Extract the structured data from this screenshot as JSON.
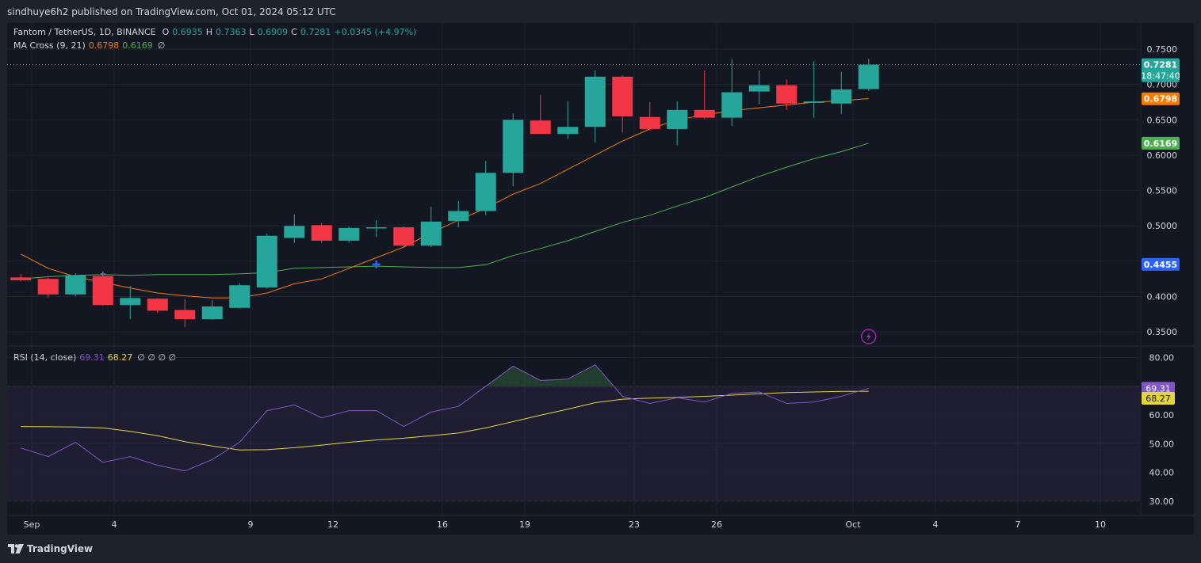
{
  "header": {
    "published_text": "sindhuye6h2 published on TradingView.com, Oct 01, 2024 05:12 UTC"
  },
  "main_legend": {
    "symbol": "Fantom / TetherUS, 1D, BINANCE",
    "o_label": "O",
    "o_value": "0.6935",
    "h_label": "H",
    "h_value": "0.7363",
    "l_label": "L",
    "l_value": "0.6909",
    "c_label": "C",
    "c_value": "0.7281",
    "change": "+0.0345 (+4.97%)"
  },
  "ma_legend": {
    "name": "MA Cross (9, 21)",
    "fast": "0.6798",
    "slow": "0.6169",
    "ghost": "∅"
  },
  "rsi_legend": {
    "name": "RSI (14, close)",
    "rsi": "69.31",
    "ma": "68.27",
    "ghosts": "∅ ∅ ∅ ∅"
  },
  "footer": {
    "brand": "TradingView",
    "logo_icon": "tradingview-logo-icon"
  },
  "colors": {
    "up": "#26a69a",
    "down": "#f23645",
    "ma_fast": "#f57c00",
    "ma_slow": "#4caf50",
    "rsi": "#7e57c2",
    "rsi_ma": "#e6d539",
    "cross_marker": "#2962ff"
  },
  "price_axis": {
    "ticks": [
      "0.7500",
      "0.7000",
      "0.6500",
      "0.6000",
      "0.5500",
      "0.5000",
      "0.4500",
      "0.4000",
      "0.3500"
    ],
    "badges": [
      {
        "label": "0.7281",
        "sub": "18:47:40",
        "color": "#26a69a"
      },
      {
        "label": "0.6798",
        "color": "#f57c00"
      },
      {
        "label": "0.6169",
        "color": "#4caf50"
      },
      {
        "label": "0.4455",
        "color": "#2962ff"
      }
    ]
  },
  "rsi_axis": {
    "ticks": [
      "80.00",
      "70.00",
      "60.00",
      "50.00",
      "40.00",
      "30.00"
    ],
    "badges": [
      {
        "label": "69.31",
        "color": "#7e57c2"
      },
      {
        "label": "68.27",
        "color": "#e6d539"
      }
    ]
  },
  "time_axis": {
    "labels": [
      "Sep",
      "4",
      "9",
      "12",
      "16",
      "19",
      "23",
      "26",
      "Oct",
      "4",
      "7",
      "10"
    ]
  },
  "chart_data": {
    "type": "candlestick",
    "candles": [
      {
        "o": 0.427,
        "h": 0.432,
        "l": 0.422,
        "c": 0.423
      },
      {
        "o": 0.425,
        "h": 0.427,
        "l": 0.398,
        "c": 0.403
      },
      {
        "o": 0.403,
        "h": 0.433,
        "l": 0.4,
        "c": 0.43
      },
      {
        "o": 0.429,
        "h": 0.434,
        "l": 0.387,
        "c": 0.388
      },
      {
        "o": 0.388,
        "h": 0.415,
        "l": 0.368,
        "c": 0.398
      },
      {
        "o": 0.397,
        "h": 0.398,
        "l": 0.377,
        "c": 0.38
      },
      {
        "o": 0.381,
        "h": 0.396,
        "l": 0.357,
        "c": 0.368
      },
      {
        "o": 0.368,
        "h": 0.395,
        "l": 0.367,
        "c": 0.386
      },
      {
        "o": 0.384,
        "h": 0.419,
        "l": 0.383,
        "c": 0.416
      },
      {
        "o": 0.413,
        "h": 0.489,
        "l": 0.411,
        "c": 0.486
      },
      {
        "o": 0.483,
        "h": 0.516,
        "l": 0.476,
        "c": 0.5
      },
      {
        "o": 0.501,
        "h": 0.504,
        "l": 0.476,
        "c": 0.479
      },
      {
        "o": 0.479,
        "h": 0.499,
        "l": 0.476,
        "c": 0.497
      },
      {
        "o": 0.497,
        "h": 0.508,
        "l": 0.484,
        "c": 0.498
      },
      {
        "o": 0.498,
        "h": 0.499,
        "l": 0.47,
        "c": 0.472
      },
      {
        "o": 0.472,
        "h": 0.527,
        "l": 0.47,
        "c": 0.506
      },
      {
        "o": 0.507,
        "h": 0.535,
        "l": 0.498,
        "c": 0.521
      },
      {
        "o": 0.521,
        "h": 0.592,
        "l": 0.515,
        "c": 0.575
      },
      {
        "o": 0.575,
        "h": 0.659,
        "l": 0.556,
        "c": 0.65
      },
      {
        "o": 0.649,
        "h": 0.685,
        "l": 0.63,
        "c": 0.63
      },
      {
        "o": 0.63,
        "h": 0.676,
        "l": 0.623,
        "c": 0.64
      },
      {
        "o": 0.64,
        "h": 0.72,
        "l": 0.618,
        "c": 0.711
      },
      {
        "o": 0.711,
        "h": 0.713,
        "l": 0.632,
        "c": 0.655
      },
      {
        "o": 0.654,
        "h": 0.675,
        "l": 0.635,
        "c": 0.637
      },
      {
        "o": 0.637,
        "h": 0.676,
        "l": 0.614,
        "c": 0.664
      },
      {
        "o": 0.664,
        "h": 0.72,
        "l": 0.651,
        "c": 0.653
      },
      {
        "o": 0.653,
        "h": 0.736,
        "l": 0.641,
        "c": 0.689
      },
      {
        "o": 0.69,
        "h": 0.72,
        "l": 0.672,
        "c": 0.699
      },
      {
        "o": 0.699,
        "h": 0.707,
        "l": 0.664,
        "c": 0.673
      },
      {
        "o": 0.674,
        "h": 0.733,
        "l": 0.653,
        "c": 0.676
      },
      {
        "o": 0.673,
        "h": 0.718,
        "l": 0.658,
        "c": 0.693
      },
      {
        "o": 0.6935,
        "h": 0.7363,
        "l": 0.6909,
        "c": 0.7281
      }
    ],
    "ma_fast": [
      0.46,
      0.44,
      0.428,
      0.42,
      0.412,
      0.405,
      0.401,
      0.398,
      0.398,
      0.405,
      0.418,
      0.425,
      0.44,
      0.455,
      0.47,
      0.49,
      0.508,
      0.525,
      0.545,
      0.56,
      0.58,
      0.6,
      0.62,
      0.637,
      0.65,
      0.657,
      0.663,
      0.667,
      0.671,
      0.675,
      0.677,
      0.68
    ],
    "ma_slow": [
      0.425,
      0.428,
      0.43,
      0.431,
      0.43,
      0.431,
      0.431,
      0.431,
      0.432,
      0.434,
      0.44,
      0.441,
      0.442,
      0.443,
      0.442,
      0.441,
      0.441,
      0.445,
      0.458,
      0.468,
      0.479,
      0.492,
      0.505,
      0.515,
      0.528,
      0.54,
      0.555,
      0.57,
      0.583,
      0.595,
      0.605,
      0.617
    ],
    "rsi": [
      48.5,
      45.5,
      50.5,
      43.5,
      45.5,
      42.5,
      40.5,
      44.5,
      50.5,
      61.5,
      63.5,
      59.0,
      61.5,
      61.5,
      56.0,
      61.0,
      63.0,
      70.0,
      77.0,
      72.0,
      72.5,
      77.5,
      66.5,
      64.0,
      66.0,
      64.5,
      67.5,
      68.0,
      64.0,
      64.5,
      66.5,
      69.31
    ],
    "rsi_ma": [
      56.0,
      55.9,
      55.8,
      55.5,
      54.3,
      52.8,
      50.7,
      49.2,
      47.8,
      47.9,
      48.6,
      49.5,
      50.5,
      51.3,
      51.9,
      52.8,
      53.7,
      55.5,
      57.7,
      59.9,
      62.0,
      64.3,
      65.5,
      65.9,
      66.1,
      66.5,
      66.9,
      67.4,
      67.8,
      68.0,
      68.2,
      68.27
    ],
    "price_range": [
      0.33,
      0.787
    ],
    "rsi_range": [
      25,
      84
    ],
    "rsi_levels": [
      70,
      50,
      30
    ],
    "cross_marker": {
      "bar": 13,
      "value": 0.4455
    },
    "prev_marker_bar": 3
  }
}
